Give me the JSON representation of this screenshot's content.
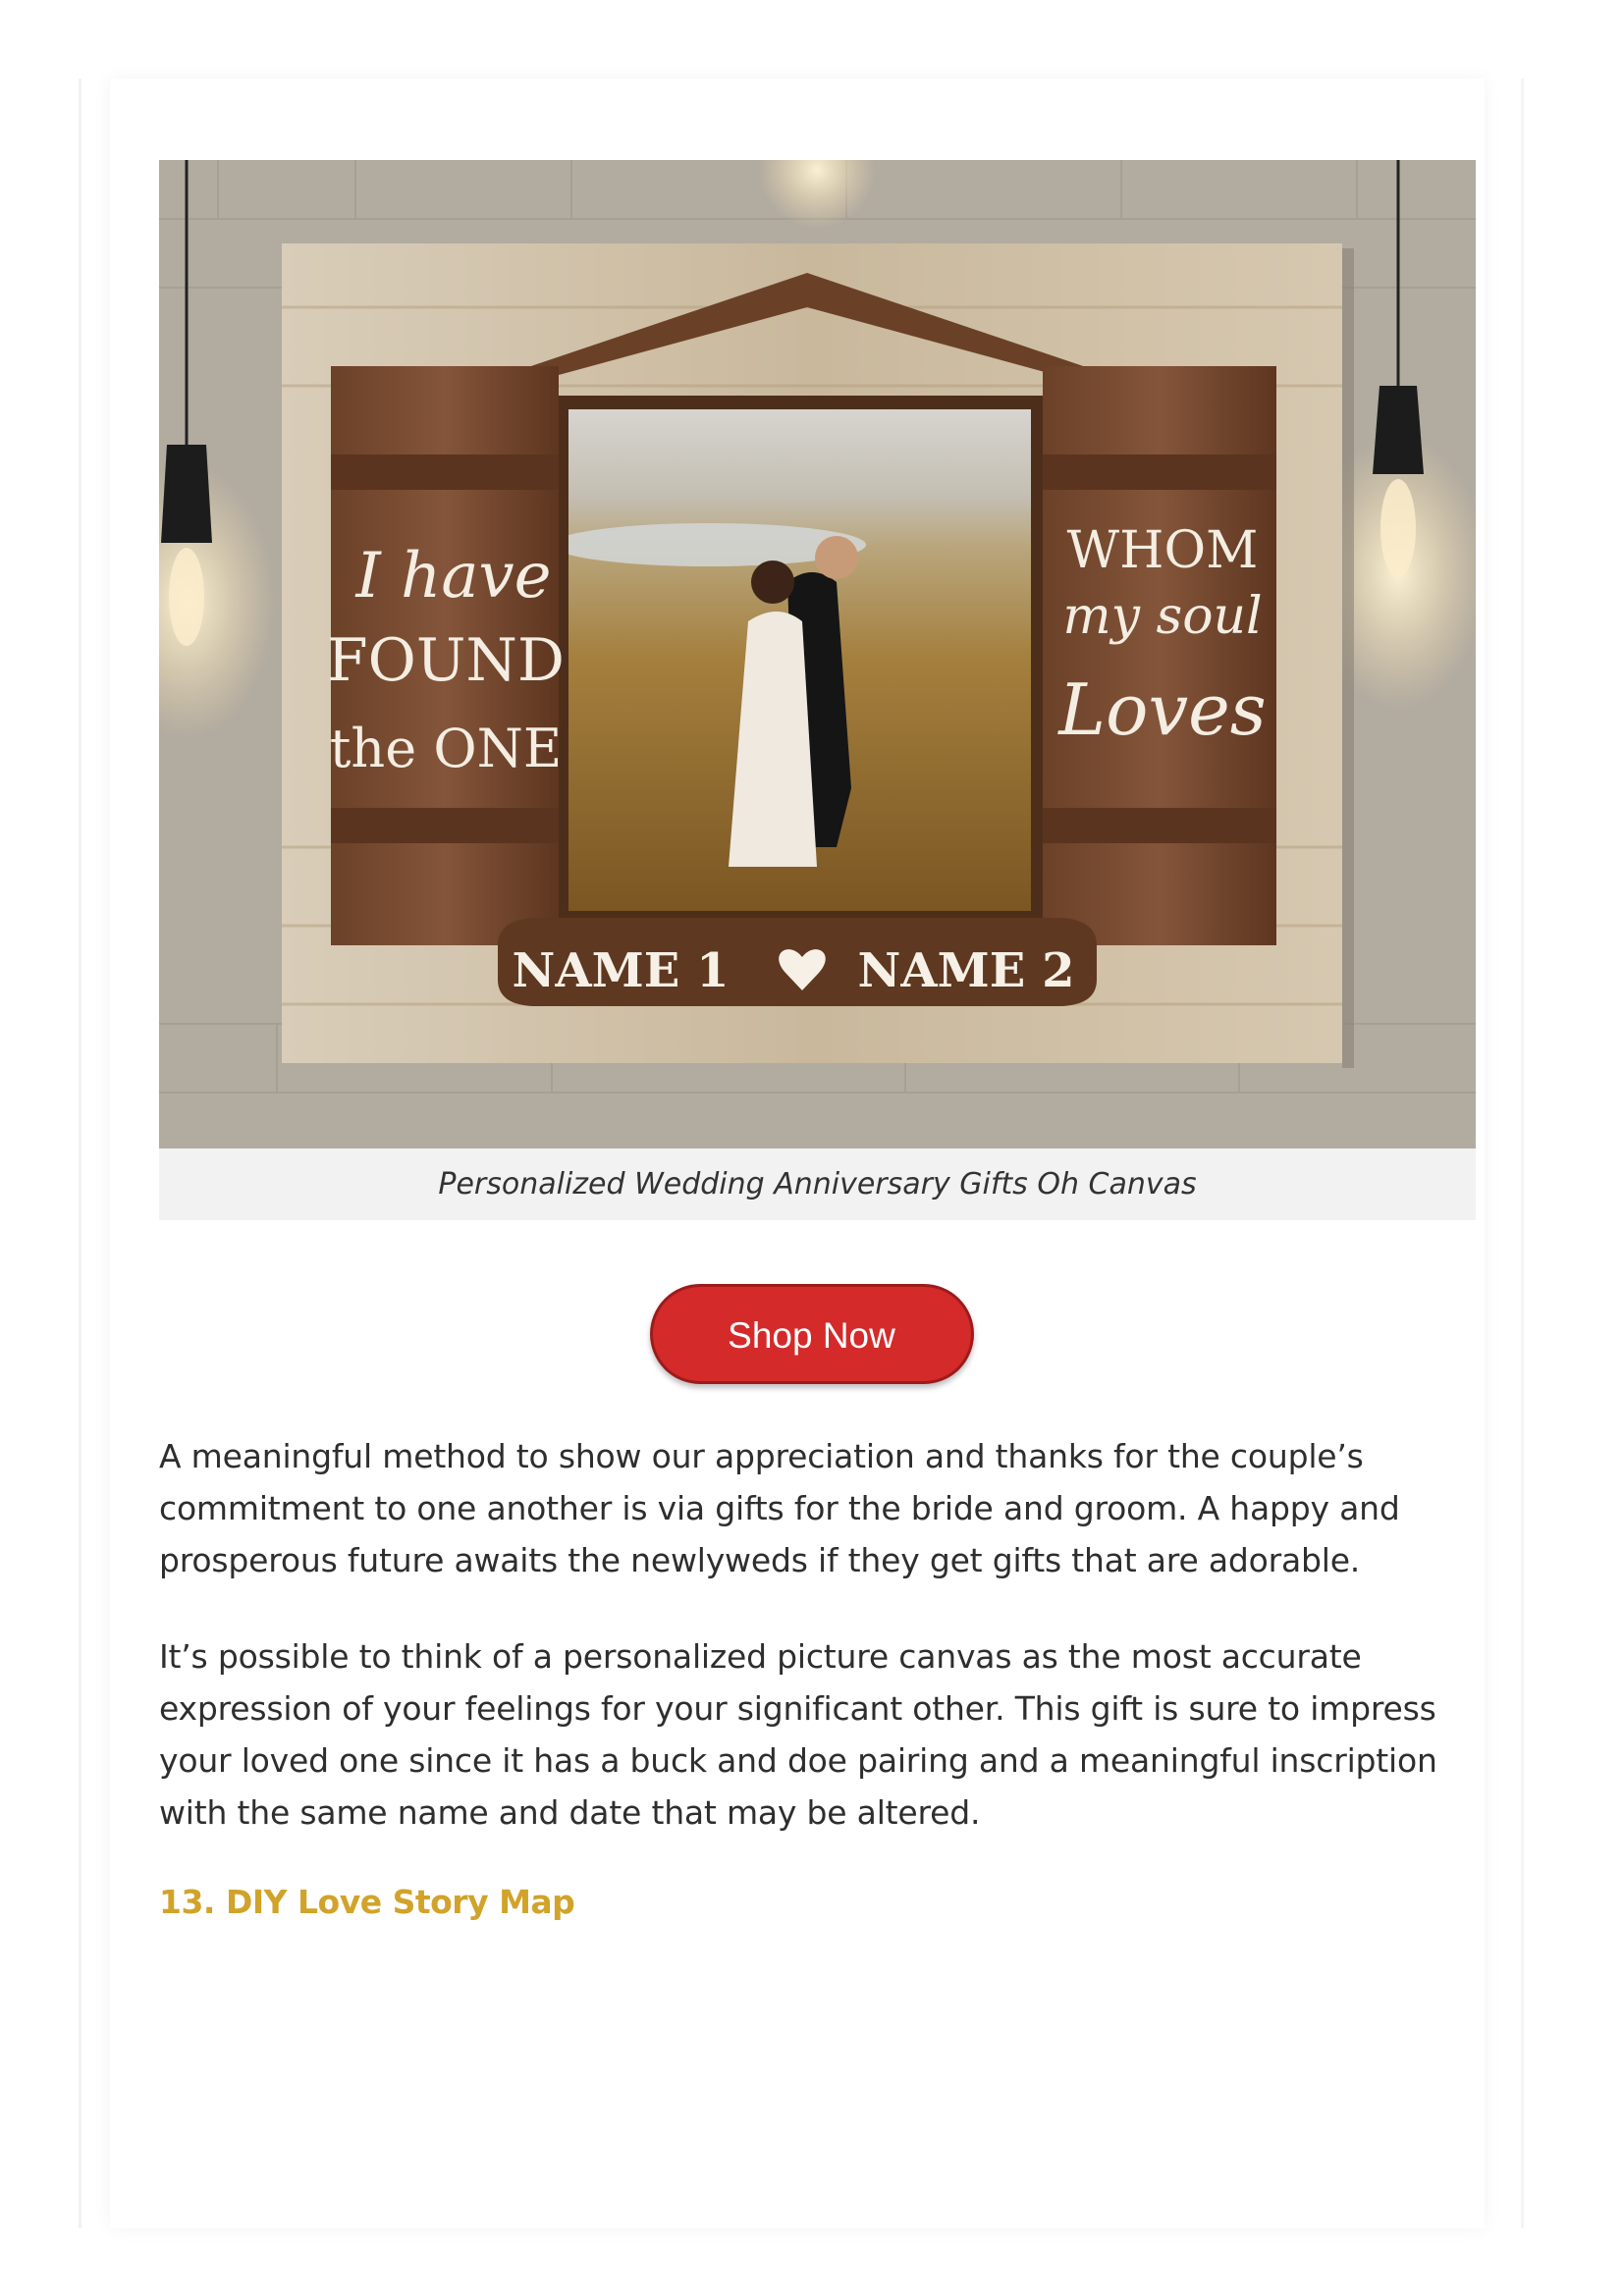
{
  "product": {
    "image_text": {
      "left_panel": [
        "I have",
        "FOUND",
        "the ONE"
      ],
      "right_panel": [
        "WHOM",
        "my soul",
        "Loves"
      ],
      "name_1": "NAME 1",
      "name_2": "NAME 2"
    },
    "caption": "Personalized Wedding Anniversary Gifts Oh Canvas"
  },
  "cta": {
    "label": "Shop Now",
    "color": "#d42a2a"
  },
  "article": {
    "paragraph_1": "A meaningful method to show our appreciation and thanks for the couple’s commitment to one another is via gifts for the bride and groom. A happy and prosperous future awaits the newlyweds if they get gifts that are adorable.",
    "paragraph_2": "It’s possible to think of a personalized picture canvas as the most accurate expression of your feelings for your significant other. This gift is sure to impress your loved one since it has a buck and doe pairing and a meaningful inscription with the same name and date that may be altered.",
    "next_heading": "13. DIY Love Story Map",
    "heading_color": "#d1a32a"
  }
}
